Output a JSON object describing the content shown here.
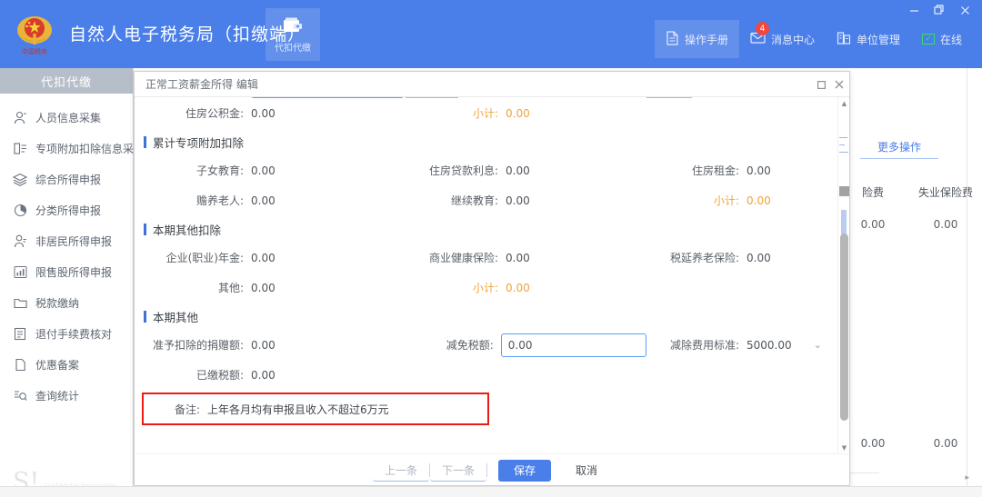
{
  "window": {
    "minimize": "−",
    "restore": "restore-icon",
    "close": "✕"
  },
  "header": {
    "title": "自然人电子税务局（扣缴端）",
    "emblem_alt": "national-emblem",
    "module_tab": {
      "label": "代扣代缴",
      "icon": "wallet-icon"
    },
    "actions": [
      {
        "label": "操作手册",
        "icon": "document-icon",
        "highlighted": true,
        "badge": null
      },
      {
        "label": "消息中心",
        "icon": "envelope-icon",
        "highlighted": false,
        "badge": "4"
      },
      {
        "label": "单位管理",
        "icon": "building-icon",
        "highlighted": false,
        "badge": null
      },
      {
        "label": "在线",
        "icon": "monitor-check-icon",
        "highlighted": false,
        "badge": null
      }
    ]
  },
  "sidebar": {
    "header": "代扣代缴",
    "items": [
      {
        "label": "人员信息采集",
        "icon": "person-icon"
      },
      {
        "label": "专项附加扣除信息采集",
        "icon": "list-form-icon"
      },
      {
        "label": "综合所得申报",
        "icon": "layers-icon"
      },
      {
        "label": "分类所得申报",
        "icon": "pie-clock-icon"
      },
      {
        "label": "非居民所得申报",
        "icon": "person-arrow-icon"
      },
      {
        "label": "限售股所得申报",
        "icon": "bar-chart-icon"
      },
      {
        "label": "税款缴纳",
        "icon": "folder-icon"
      },
      {
        "label": "退付手续费核对",
        "icon": "receipt-icon"
      },
      {
        "label": "优惠备案",
        "icon": "page-icon"
      },
      {
        "label": "查询统计",
        "icon": "search-list-icon"
      }
    ],
    "watermark": {
      "mark": "S!",
      "text": "systemtechnologies"
    }
  },
  "background": {
    "more_actions": "更多操作",
    "table": {
      "headers": [
        "险费",
        "失业保险费"
      ],
      "rows": [
        [
          "0.00",
          "0.00"
        ],
        [
          "0.00",
          "0.00"
        ]
      ]
    },
    "scroll_right_arrow": "▸"
  },
  "dialog": {
    "title": "正常工资薪金所得 编辑",
    "controls": {
      "maximize": "maximize-icon",
      "close": "close-icon"
    },
    "rows_top": [
      {
        "fields": [
          {
            "label": "住房公积金:",
            "value": "0.00",
            "type": "text",
            "col": "c1"
          },
          {
            "label": "小计:",
            "value": "0.00",
            "type": "subtotal",
            "col": "c2"
          },
          {
            "label": "",
            "value": "",
            "type": "blank",
            "col": "c3"
          }
        ]
      }
    ],
    "sections": [
      {
        "title": "累计专项附加扣除",
        "rows": [
          {
            "fields": [
              {
                "label": "子女教育:",
                "value": "0.00",
                "type": "text",
                "col": "c1"
              },
              {
                "label": "住房贷款利息:",
                "value": "0.00",
                "type": "text",
                "col": "c2"
              },
              {
                "label": "住房租金:",
                "value": "0.00",
                "type": "text",
                "col": "c3"
              }
            ]
          },
          {
            "fields": [
              {
                "label": "赡养老人:",
                "value": "0.00",
                "type": "text",
                "col": "c1"
              },
              {
                "label": "继续教育:",
                "value": "0.00",
                "type": "text",
                "col": "c2"
              },
              {
                "label": "小计:",
                "value": "0.00",
                "type": "subtotal",
                "col": "c3"
              }
            ]
          }
        ]
      },
      {
        "title": "本期其他扣除",
        "rows": [
          {
            "fields": [
              {
                "label": "企业(职业)年金:",
                "value": "0.00",
                "type": "text",
                "col": "c1"
              },
              {
                "label": "商业健康保险:",
                "value": "0.00",
                "type": "text",
                "col": "c2"
              },
              {
                "label": "税延养老保险:",
                "value": "0.00",
                "type": "text",
                "col": "c3"
              }
            ]
          },
          {
            "fields": [
              {
                "label": "其他:",
                "value": "0.00",
                "type": "text",
                "col": "c1"
              },
              {
                "label": "小计:",
                "value": "0.00",
                "type": "subtotal",
                "col": "c2"
              },
              {
                "label": "",
                "value": "",
                "type": "blank",
                "col": "c3"
              }
            ]
          }
        ]
      },
      {
        "title": "本期其他",
        "rows": [
          {
            "fields": [
              {
                "label": "准予扣除的捐赠额:",
                "value": "0.00",
                "type": "text",
                "col": "c1"
              },
              {
                "label": "减免税额:",
                "value": "0.00",
                "type": "input",
                "col": "c2"
              },
              {
                "label": "减除费用标准:",
                "value": "5000.00",
                "type": "select",
                "col": "c3",
                "chevron": "⌄"
              }
            ]
          },
          {
            "fields": [
              {
                "label": "已缴税额:",
                "value": "0.00",
                "type": "text",
                "col": "c1"
              },
              {
                "label": "",
                "value": "",
                "type": "blank",
                "col": "c2"
              },
              {
                "label": "",
                "value": "",
                "type": "blank",
                "col": "c3"
              }
            ]
          }
        ]
      }
    ],
    "remark": {
      "label": "备注:",
      "value": "上年各月均有申报且收入不超过6万元",
      "highlight_color": "#ee1b15"
    },
    "footer": {
      "prev": "上一条",
      "next": "下一条",
      "save": "保存",
      "cancel": "取消"
    },
    "scrollbar": {
      "up": "▲",
      "down": "▼"
    }
  },
  "colors": {
    "brand_blue": "#4a7ee8",
    "subtotal_orange": "#f0a33c",
    "alert_red": "#ee1b15",
    "sidebar_head": "#b6bfc9"
  }
}
